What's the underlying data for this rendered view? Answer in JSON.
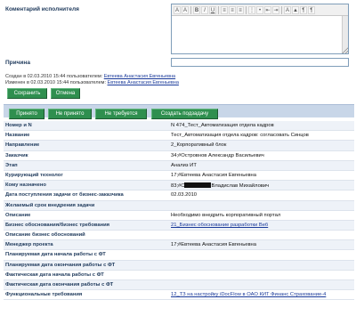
{
  "comment": {
    "label": "Коментарий исполнителя"
  },
  "reason": {
    "label": "Причина",
    "value": ""
  },
  "meta": {
    "created_prefix": "Создан в 02.03.2010 15:44 пользователем:",
    "created_user": "Евтеева Анастасия Евгеньевна",
    "modified_prefix": "Изменен в 02.03.2010 15:44 пользователем:",
    "modified_user": "Евтеева Анастасия Евгеньевна"
  },
  "buttons": {
    "save": "Сохранить",
    "cancel": "Отмена",
    "accept": "Принято",
    "reject": "Не принято",
    "not_needed": "Не требуется",
    "create_subtask": "Создать подзадачу"
  },
  "details": [
    {
      "label": "Номер и N",
      "value": "N 474_Тест_Автоматизация отдела кадров"
    },
    {
      "label": "Название",
      "value": "Тест_Автоматизация отдела кадров: согласовать Синцов"
    },
    {
      "label": "Направление",
      "value": "2_Корпоративный блок"
    },
    {
      "label": "Заказчик",
      "value": "34;#Островнов Александр Васильевич"
    },
    {
      "label": "Этап",
      "value": "Анализ ИТ"
    },
    {
      "label": "Курирующий технолог",
      "value": "17;#Евтеева Анастасия Евгеньевна"
    },
    {
      "label": "Кому назначено",
      "value_prefix": "83;#С",
      "value_suffix": "Владислав Михайлович"
    },
    {
      "label": "Дата поступления задачи от бизнес-заказчика",
      "value": "02.03.2010"
    },
    {
      "label": "Желаемый срок внедрения задачи",
      "value": ""
    },
    {
      "label": "Описание",
      "value": "Необходимо внедрить корпоративный портал"
    },
    {
      "label": "Бизнес обоснования/бизнес требования",
      "value": "21_Бизнес обоснование разработки Веб",
      "link": true
    },
    {
      "label": "Описание бизнес обоснований",
      "value": ""
    },
    {
      "label": "Менеджер проекта",
      "value": "17;#Евтеева Анастасия Евгеньевна"
    },
    {
      "label": "Планируемая дата начала работы с ФТ",
      "value": ""
    },
    {
      "label": "Планируемая дата окончания работы с ФТ",
      "value": ""
    },
    {
      "label": "Фактическая дата начала работы с ФТ",
      "value": ""
    },
    {
      "label": "Фактическая дата окончания работы с ФТ",
      "value": ""
    },
    {
      "label": "Функциональные требования",
      "value": "12_ТЗ на настройку iDocFlow в ОАО КИТ Финанс Страхование-4",
      "link": true
    }
  ]
}
